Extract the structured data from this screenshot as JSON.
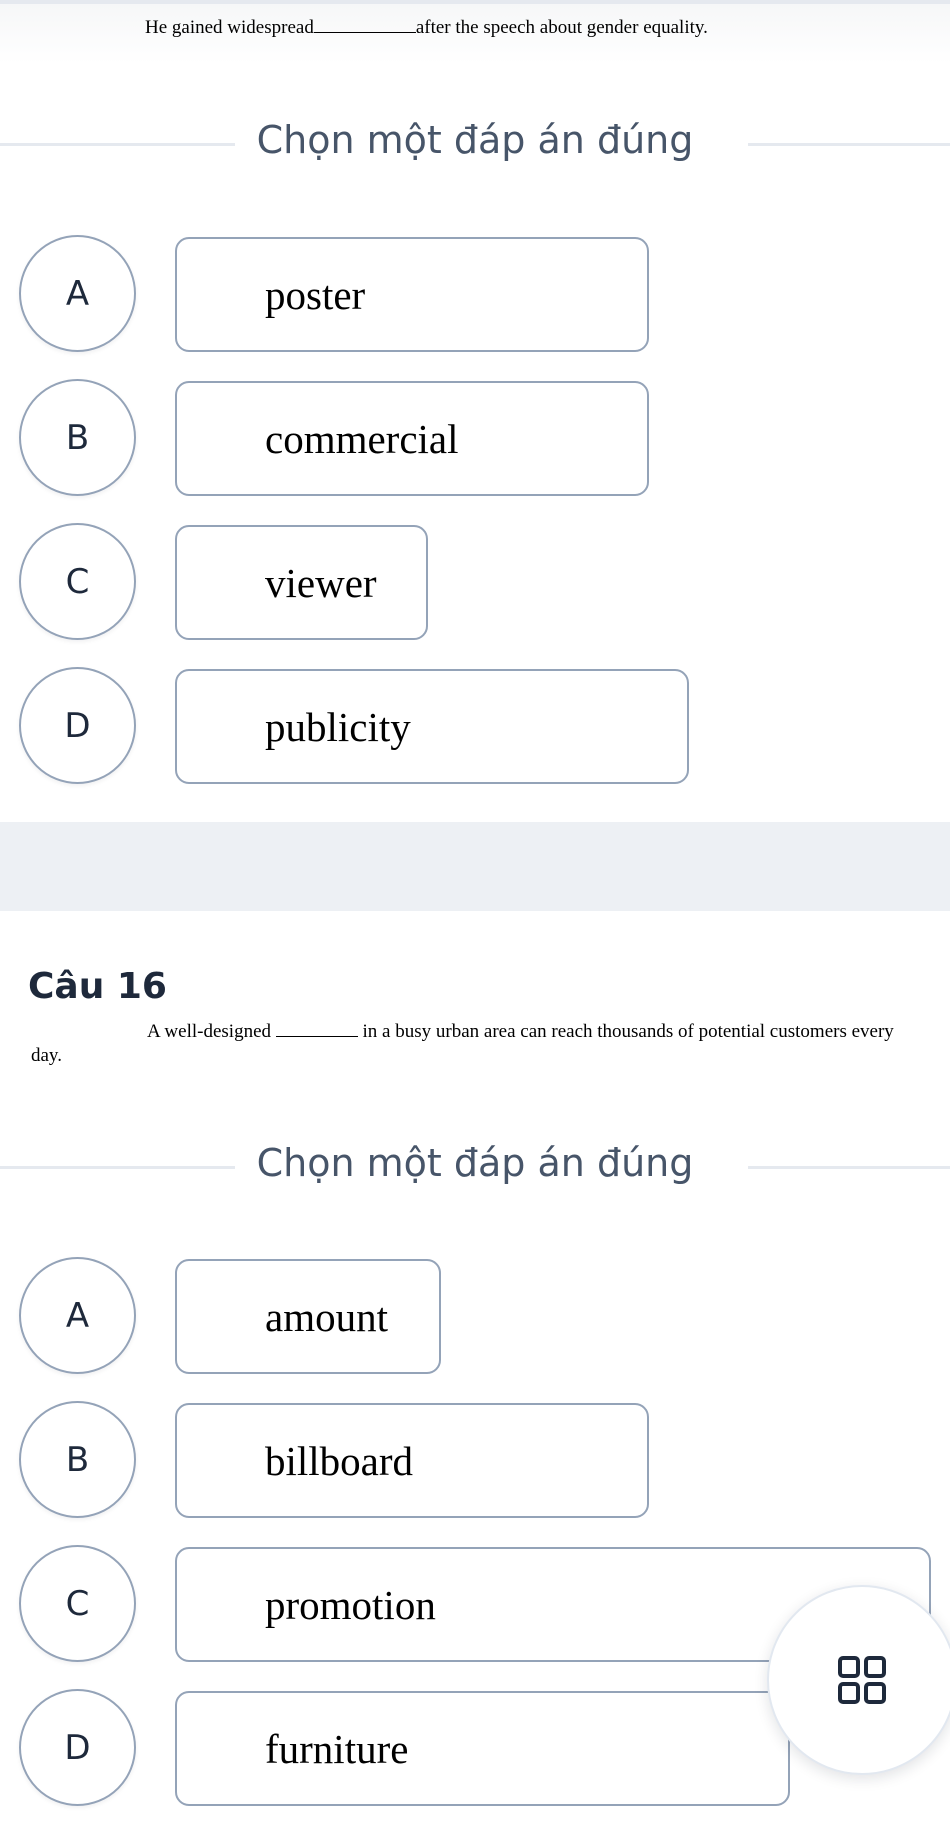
{
  "question_15": {
    "sentence_before": "He gained widespread",
    "sentence_after": "after the speech about gender equality.",
    "prompt": "Chọn một đáp án đúng",
    "options": [
      {
        "letter": "A",
        "text": "poster"
      },
      {
        "letter": "B",
        "text": "commercial"
      },
      {
        "letter": "C",
        "text": "viewer"
      },
      {
        "letter": "D",
        "text": "publicity"
      }
    ]
  },
  "question_16": {
    "title": "Câu 16",
    "sentence_before": "A well-designed",
    "sentence_after": "in a busy urban area can reach thousands of potential customers every",
    "sentence_end": "day.",
    "prompt": "Chọn một đáp án đúng",
    "options": [
      {
        "letter": "A",
        "text": "amount"
      },
      {
        "letter": "B",
        "text": "billboard"
      },
      {
        "letter": "C",
        "text": "promotion"
      },
      {
        "letter": "D",
        "text": "furniture"
      }
    ]
  },
  "fab": {
    "icon": "grid-icon"
  },
  "colors": {
    "border": "#94a3b8",
    "title": "#475569",
    "heading": "#1e293b",
    "band": "#edf0f4"
  }
}
